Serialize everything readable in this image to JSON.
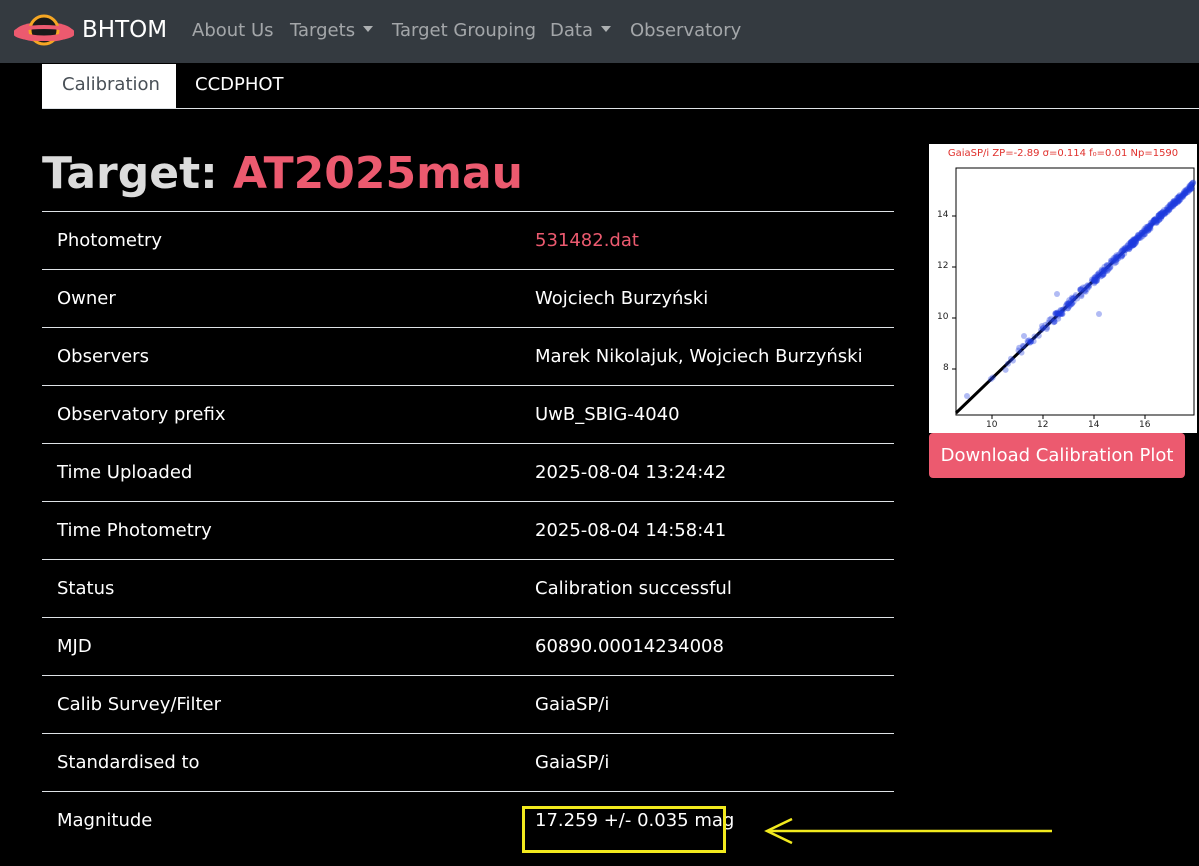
{
  "navbar": {
    "brand": "BHTOM",
    "links": [
      "About Us",
      "Targets",
      "Target Grouping",
      "Data",
      "Observatory"
    ]
  },
  "tabs": [
    "Calibration",
    "CCDPHOT"
  ],
  "title": {
    "label": "Target:",
    "target": "AT2025mau"
  },
  "rows": [
    {
      "key": "Photometry",
      "value": "531482.dat"
    },
    {
      "key": "Owner",
      "value": "Wojciech Burzyński"
    },
    {
      "key": "Observers",
      "value": "Marek Nikolajuk, Wojciech Burzyński"
    },
    {
      "key": "Observatory prefix",
      "value": "UwB_SBIG-4040"
    },
    {
      "key": "Time Uploaded",
      "value": "2025-08-04 13:24:42"
    },
    {
      "key": "Time Photometry",
      "value": "2025-08-04 14:58:41"
    },
    {
      "key": "Status",
      "value": "Calibration successful"
    },
    {
      "key": "MJD",
      "value": "60890.00014234008"
    },
    {
      "key": "Calib Survey/Filter",
      "value": "GaiaSP/i"
    },
    {
      "key": "Standardised to",
      "value": "GaiaSP/i"
    },
    {
      "key": "Magnitude",
      "value": "17.259 +/- 0.035 mag"
    }
  ],
  "plot": {
    "title": "GaiaSP/i ZP=-2.89 σ=0.114 f₀=0.01 Np=1590",
    "x_ticks": [
      "10",
      "12",
      "14",
      "16"
    ],
    "y_ticks": [
      "14",
      "12",
      "10",
      "8"
    ]
  },
  "download_button": "Download Calibration Plot",
  "colors": {
    "accent": "#ec5a6f",
    "navbar": "#343a40",
    "highlight": "#f2ea1e"
  }
}
